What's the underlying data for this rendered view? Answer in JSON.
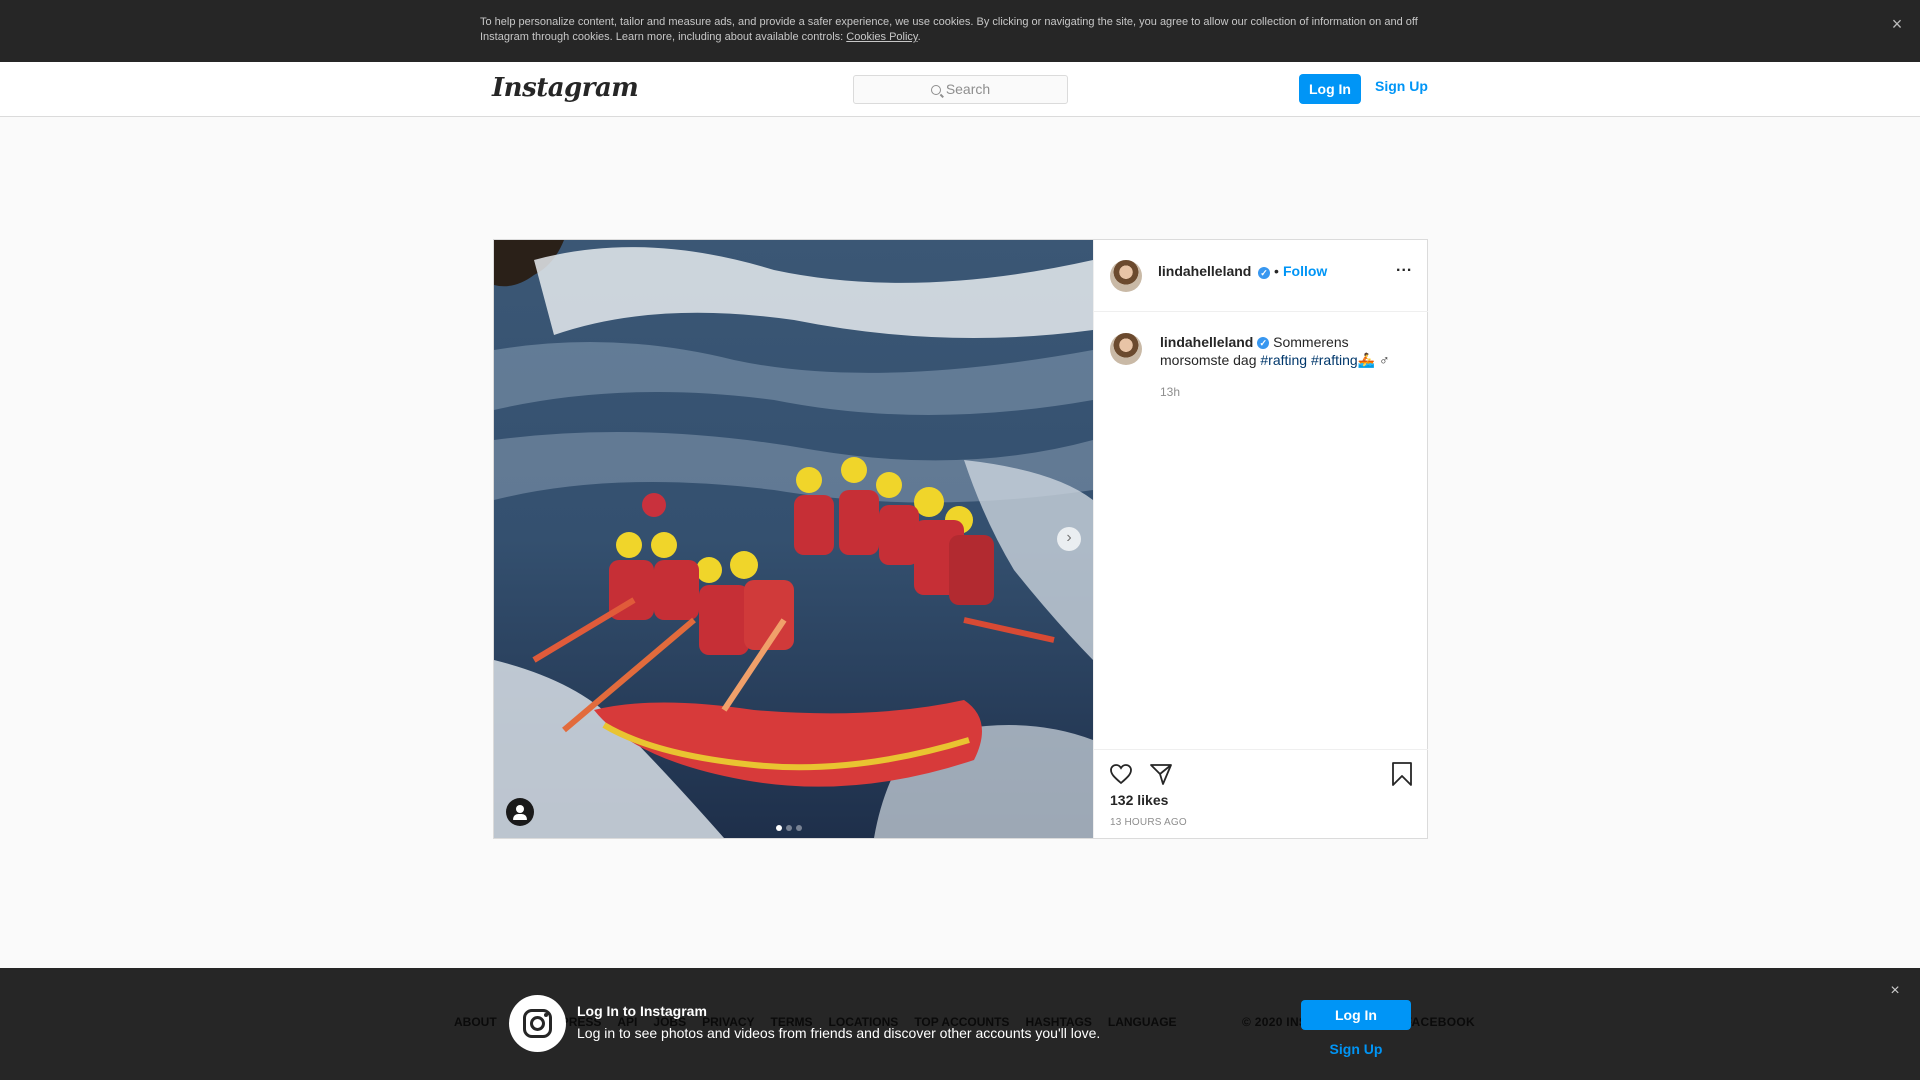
{
  "cookie_banner": {
    "text": "To help personalize content, tailor and measure ads, and provide a safer experience, we use cookies. By clicking or navigating the site, you agree to allow our collection of information on and off Instagram through cookies. Learn more, including about available controls: ",
    "link": "Cookies Policy",
    "link_suffix": ".",
    "close": "×"
  },
  "header": {
    "logo": "Instagram",
    "search_placeholder": "Search",
    "login": "Log In",
    "signup": "Sign Up"
  },
  "post": {
    "username": "lindahelleland",
    "follow_separator": "•",
    "follow": "Follow",
    "more": "...",
    "caption_text_1": "Sommerens morsomste dag ",
    "hashtag_1": "#rafting",
    "hashtag_2": "#rafting",
    "caption_tail": "🚣 ♂",
    "caption_time": "13h",
    "likes": "132 likes",
    "time_ago": "13 HOURS AGO",
    "next_arrow": "›",
    "carousel_count": 3,
    "carousel_active": 0
  },
  "bottom_bar": {
    "footer_links": [
      "ABOUT",
      "HELP",
      "PRESS",
      "API",
      "JOBS",
      "PRIVACY",
      "TERMS",
      "LOCATIONS",
      "TOP ACCOUNTS",
      "HASHTAGS",
      "LANGUAGE"
    ],
    "copyright": "© 2020 INSTAGRAM FROM FACEBOOK",
    "title": "Log In to Instagram",
    "subtitle": "Log in to see photos and videos from friends and discover other accounts you'll love.",
    "login": "Log In",
    "signup": "Sign Up",
    "close": "×"
  },
  "colors": {
    "accent": "#0095f6",
    "hashtag": "#00376b",
    "verified": "#3897f0",
    "dark_bar": "#262626"
  }
}
